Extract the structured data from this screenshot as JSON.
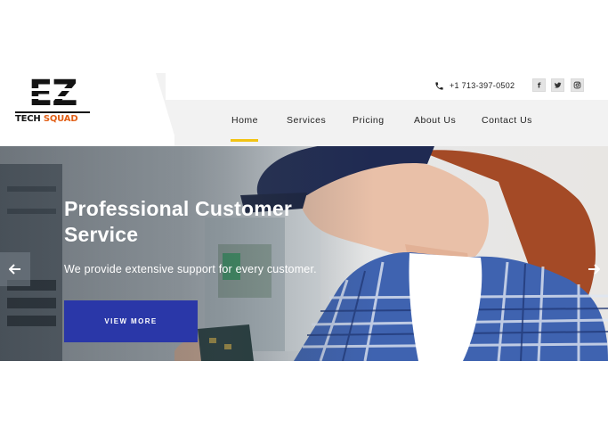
{
  "brand": {
    "logo_mark": "EZ",
    "logo_tech": "TECH",
    "logo_squad": "SQUAD",
    "accent_color": "#e25f16"
  },
  "contact": {
    "phone_icon": "phone-icon",
    "phone": "+1 713-397-0502"
  },
  "social": [
    {
      "icon": "facebook-icon",
      "glyph": "f"
    },
    {
      "icon": "twitter-icon"
    },
    {
      "icon": "instagram-icon"
    }
  ],
  "nav": {
    "active_color": "#f2c314",
    "items": [
      {
        "label": "Home",
        "active": true
      },
      {
        "label": "Services"
      },
      {
        "label": "Pricing"
      },
      {
        "label": "About Us"
      },
      {
        "label": "Contact Us"
      }
    ]
  },
  "hero": {
    "title": "Professional Customer Service",
    "subtitle": "We provide extensive support for every customer.",
    "cta_label": "VIEW MORE",
    "cta_color": "#2a37a8",
    "prev_icon": "arrow-left-icon",
    "next_icon": "arrow-right-icon"
  }
}
